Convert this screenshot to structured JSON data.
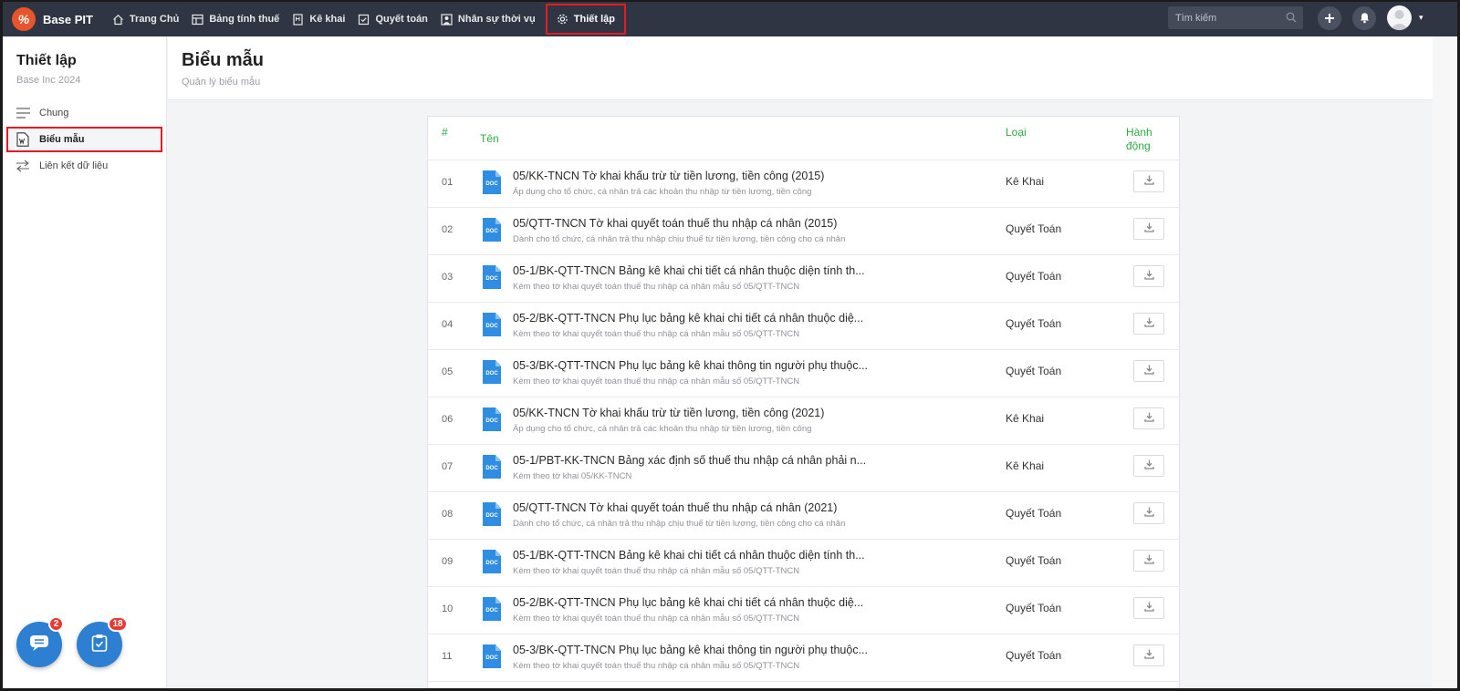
{
  "app": {
    "logo_glyph": "%",
    "name": "Base PIT"
  },
  "nav": [
    {
      "label": "Trang Chủ",
      "icon": "home-icon"
    },
    {
      "label": "Bảng tính thuế",
      "icon": "table-icon"
    },
    {
      "label": "Kê khai",
      "icon": "document-icon"
    },
    {
      "label": "Quyết toán",
      "icon": "checkbox-icon"
    },
    {
      "label": "Nhân sự thời vụ",
      "icon": "person-icon"
    },
    {
      "label": "Thiết lập",
      "icon": "gear-icon",
      "active": true
    }
  ],
  "search": {
    "placeholder": "Tìm kiếm"
  },
  "sidebar": {
    "title": "Thiết lập",
    "subtitle": "Base Inc 2024",
    "items": [
      {
        "label": "Chung",
        "icon": "menu-lines-icon"
      },
      {
        "label": "Biểu mẫu",
        "icon": "word-doc-icon",
        "active": true
      },
      {
        "label": "Liên kết dữ liệu",
        "icon": "swap-arrows-icon"
      }
    ]
  },
  "page": {
    "title": "Biểu mẫu",
    "subtitle": "Quản lý biểu mẫu"
  },
  "table": {
    "headers": {
      "num": "#",
      "name": "Tên",
      "type": "Loại",
      "action_1": "Hành",
      "action_2": "động"
    },
    "doc_label": "DOC",
    "rows": [
      {
        "num": "01",
        "title": "05/KK-TNCN Tờ khai khấu trừ từ tiền lương, tiền công (2015)",
        "desc": "Áp dụng cho tổ chức, cá nhân trả các khoản thu nhập từ tiền lương, tiền công",
        "type": "Kê Khai"
      },
      {
        "num": "02",
        "title": "05/QTT-TNCN Tờ khai quyết toán thuế thu nhập cá nhân (2015)",
        "desc": "Dành cho tổ chức, cá nhân trả thu nhập chịu thuế từ tiền lương, tiền công cho cá nhân",
        "type": "Quyết Toán"
      },
      {
        "num": "03",
        "title": "05-1/BK-QTT-TNCN Bảng kê khai chi tiết cá nhân thuộc diện tính th...",
        "desc": "Kèm theo tờ khai quyết toán thuế thu nhập cá nhân mẫu số 05/QTT-TNCN",
        "type": "Quyết Toán"
      },
      {
        "num": "04",
        "title": "05-2/BK-QTT-TNCN Phụ lục bảng kê khai chi tiết cá nhân thuộc diệ...",
        "desc": "Kèm theo tờ khai quyết toán thuế thu nhập cá nhân mẫu số 05/QTT-TNCN",
        "type": "Quyết Toán"
      },
      {
        "num": "05",
        "title": "05-3/BK-QTT-TNCN Phụ lục bảng kê khai thông tin người phụ thuộc...",
        "desc": "Kèm theo tờ khai quyết toán thuế thu nhập cá nhân mẫu số 05/QTT-TNCN",
        "type": "Quyết Toán"
      },
      {
        "num": "06",
        "title": "05/KK-TNCN Tờ khai khấu trừ từ tiền lương, tiền công (2021)",
        "desc": "Áp dụng cho tổ chức, cá nhân trả các khoản thu nhập từ tiền lương, tiền công",
        "type": "Kê Khai"
      },
      {
        "num": "07",
        "title": "05-1/PBT-KK-TNCN Bảng xác định số thuế thu nhập cá nhân phải n...",
        "desc": "Kèm theo tờ khai 05/KK-TNCN",
        "type": "Kê Khai"
      },
      {
        "num": "08",
        "title": "05/QTT-TNCN Tờ khai quyết toán thuế thu nhập cá nhân (2021)",
        "desc": "Dành cho tổ chức, cá nhân trả thu nhập chịu thuế từ tiền lương, tiền công cho cá nhân",
        "type": "Quyết Toán"
      },
      {
        "num": "09",
        "title": "05-1/BK-QTT-TNCN Bảng kê khai chi tiết cá nhân thuộc diện tính th...",
        "desc": "Kèm theo tờ khai quyết toán thuế thu nhập cá nhân mẫu số 05/QTT-TNCN",
        "type": "Quyết Toán"
      },
      {
        "num": "10",
        "title": "05-2/BK-QTT-TNCN Phụ lục bảng kê khai chi tiết cá nhân thuộc diệ...",
        "desc": "Kèm theo tờ khai quyết toán thuế thu nhập cá nhân mẫu số 05/QTT-TNCN",
        "type": "Quyết Toán"
      },
      {
        "num": "11",
        "title": "05-3/BK-QTT-TNCN Phụ lục bảng kê khai thông tin người phụ thuộc...",
        "desc": "Kèm theo tờ khai quyết toán thuế thu nhập cá nhân mẫu số 05/QTT-TNCN",
        "type": "Quyết Toán"
      }
    ]
  },
  "fabs": {
    "chat_badge": "2",
    "tasks_badge": "18"
  },
  "colors": {
    "accent_green": "#2eaa45",
    "brand_orange": "#e8542c",
    "nav_bg": "#2f3542",
    "highlight_red": "#e41b23",
    "fab_blue": "#2d7fd1"
  }
}
